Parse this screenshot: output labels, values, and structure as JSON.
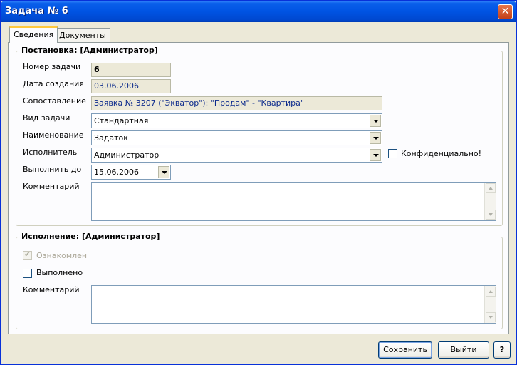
{
  "window": {
    "title": "Задача № 6",
    "close_glyph": "✕"
  },
  "tabs": [
    {
      "label": "Сведения",
      "active": true
    },
    {
      "label": "Документы",
      "active": false
    }
  ],
  "setup": {
    "title": "Постановка: [Администратор]",
    "labels": {
      "number": "Номер задачи",
      "created": "Дата создания",
      "match": "Сопоставление",
      "type": "Вид задачи",
      "name": "Наименование",
      "executor": "Исполнитель",
      "due": "Выполнить до",
      "comment": "Комментарий"
    },
    "values": {
      "number": "6",
      "created": "03.06.2006",
      "match": "Заявка № 3207 (\"Экватор\"): \"Продам\" - \"Квартира\"",
      "type": "Стандартная",
      "name": "Задаток",
      "executor": "Администратор",
      "due": "15.06.2006",
      "comment": ""
    },
    "confidential_label": "Конфиденциально!"
  },
  "execution": {
    "title": "Исполнение: [Администратор]",
    "acknowledged_label": "Ознакомлен",
    "done_label": "Выполнено",
    "comment_label": "Комментарий",
    "check_glyph": "✔"
  },
  "buttons": {
    "save": "Сохранить",
    "exit": "Выйти",
    "help": "?"
  }
}
